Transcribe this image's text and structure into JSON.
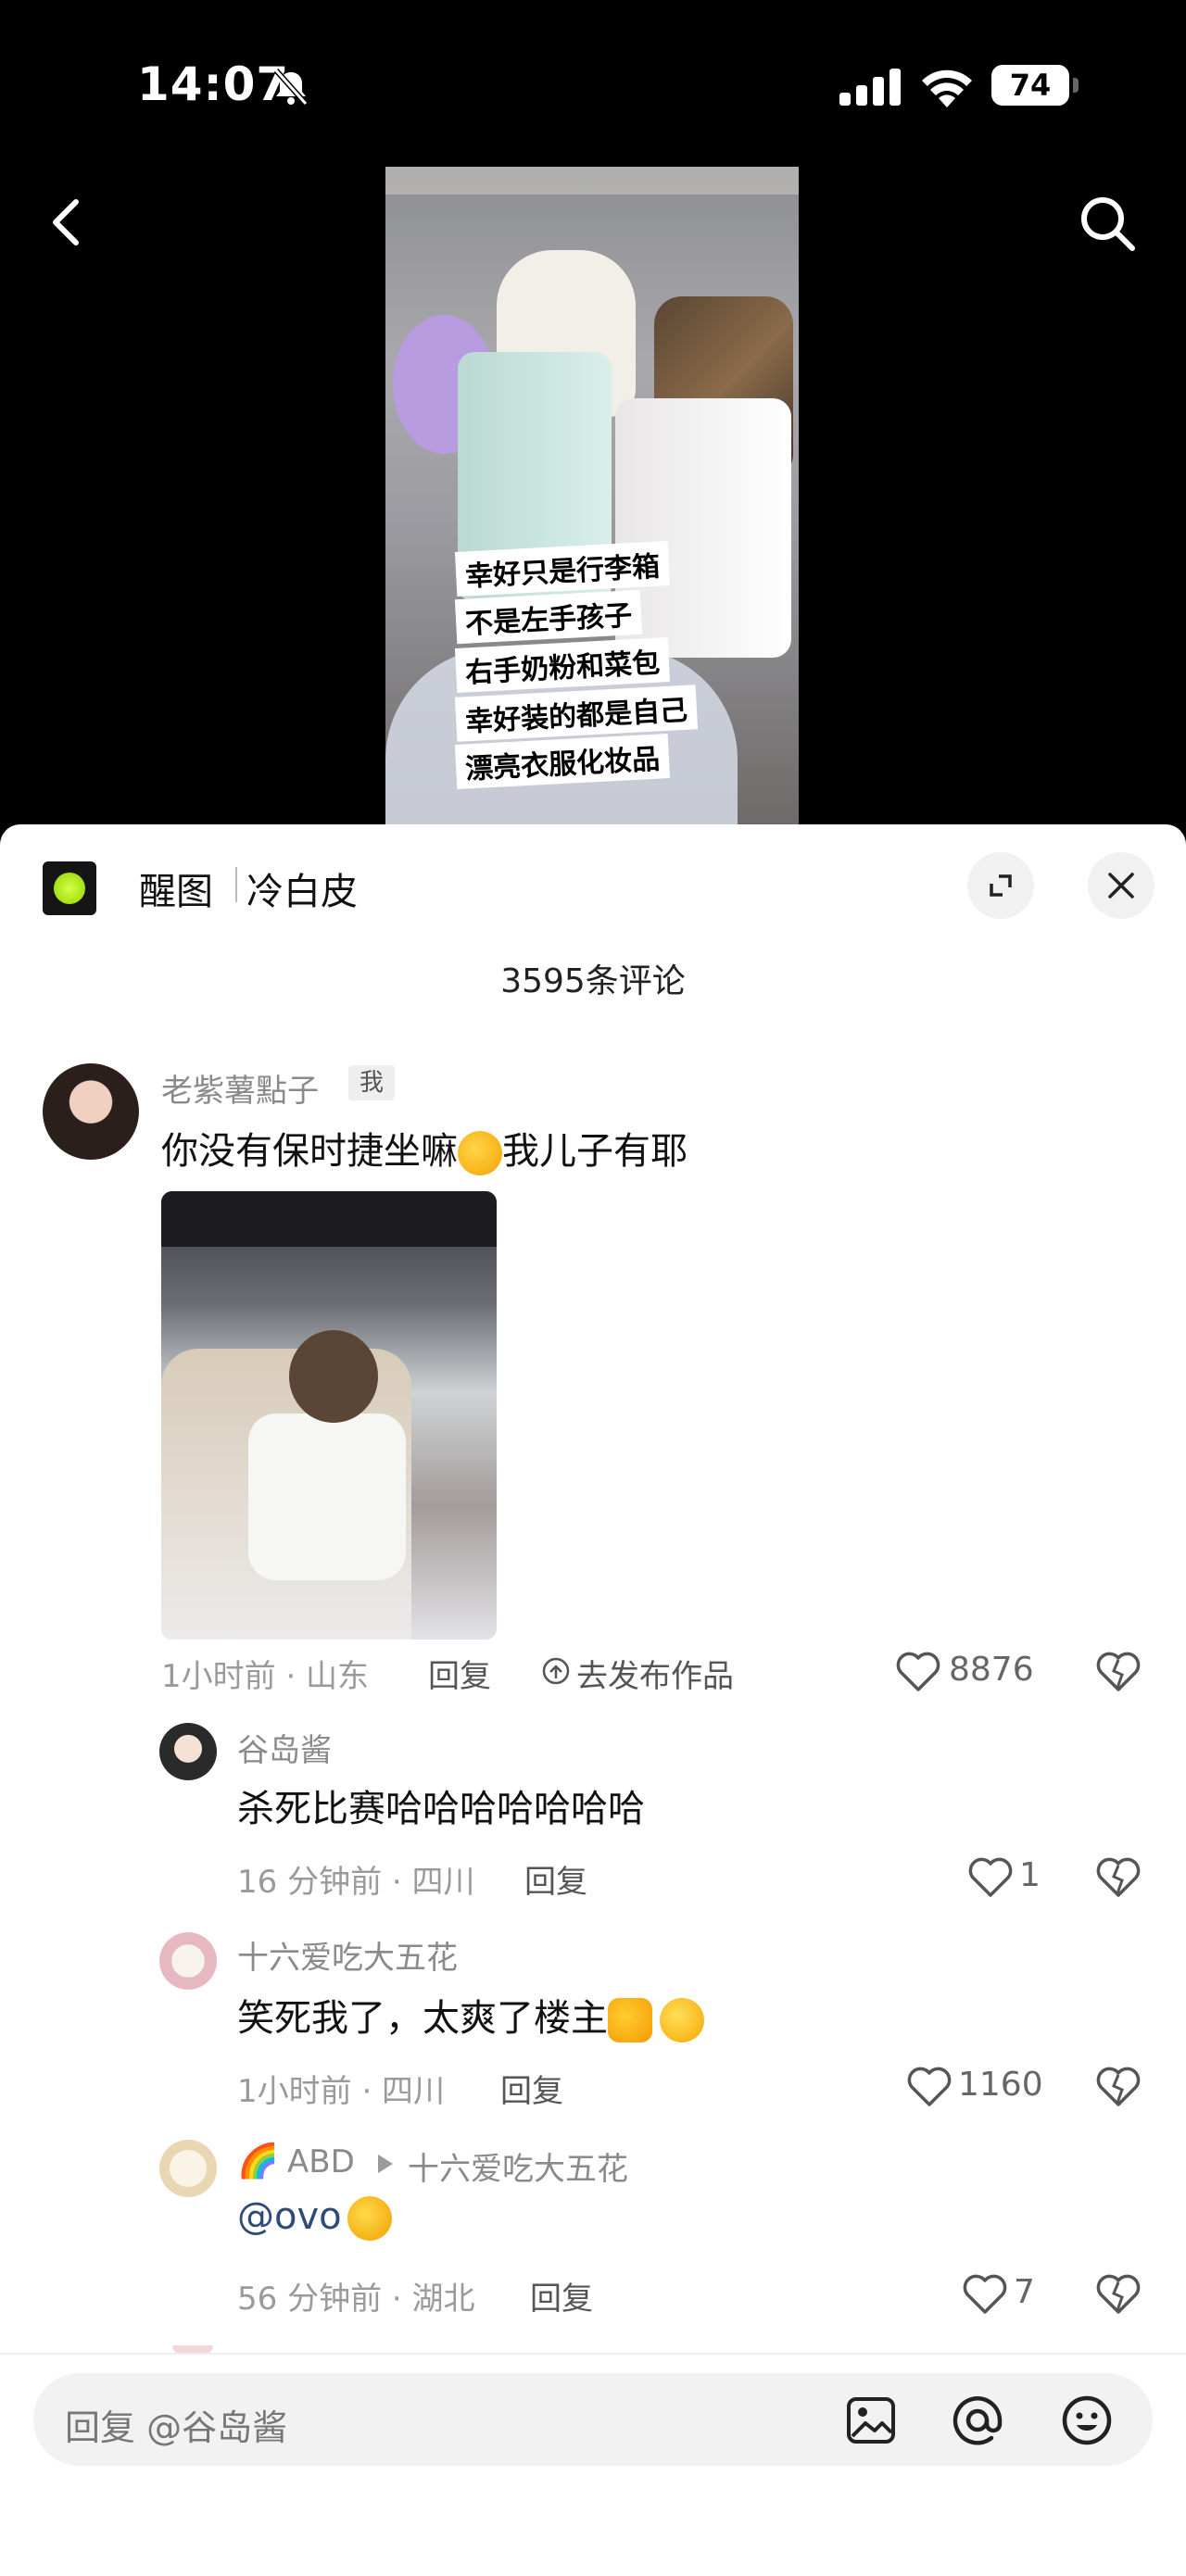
{
  "status_bar": {
    "time": "14:07",
    "battery": "74"
  },
  "video": {
    "caption_lines": [
      "幸好只是行李箱",
      "不是左手孩子",
      "右手奶粉和菜包",
      "幸好装的都是自己",
      "漂亮衣服化妆品"
    ]
  },
  "panel": {
    "app_name": "醒图",
    "filter_name": "冷白皮",
    "comment_count": "3595条评论"
  },
  "comments": [
    {
      "name": "老紫薯點子",
      "badge": "我",
      "text": "你没有保时捷坐嘛",
      "text_after_emoji": "我儿子有耶",
      "meta": "1小时前 · 山东",
      "reply": "回复",
      "publish": "去发布作品",
      "likes": "8876"
    },
    {
      "name": "谷岛酱",
      "text": "杀死比赛哈哈哈哈哈哈哈",
      "meta": "16 分钟前 · 四川",
      "reply": "回复",
      "likes": "1"
    },
    {
      "name": "十六爱吃大五花",
      "text": "笑死我了，太爽了楼主",
      "meta": "1小时前 · 四川",
      "reply": "回复",
      "likes": "1160"
    },
    {
      "name": "ABD",
      "reply_to": "十六爱吃大五花",
      "text": "@ovo",
      "meta": "56 分钟前 · 湖北",
      "reply": "回复",
      "likes": "7"
    }
  ],
  "input": {
    "placeholder": "回复 @谷岛酱"
  },
  "colors": {
    "panel_bg": "#ffffff",
    "text_primary": "#111111",
    "text_secondary": "#9a9a9a",
    "accent_logo": "#b7ef1f"
  },
  "icons": [
    "back-icon",
    "search-icon",
    "expand-icon",
    "close-icon",
    "heart-icon",
    "dislike-icon",
    "image-icon",
    "at-icon",
    "emoji-icon"
  ]
}
